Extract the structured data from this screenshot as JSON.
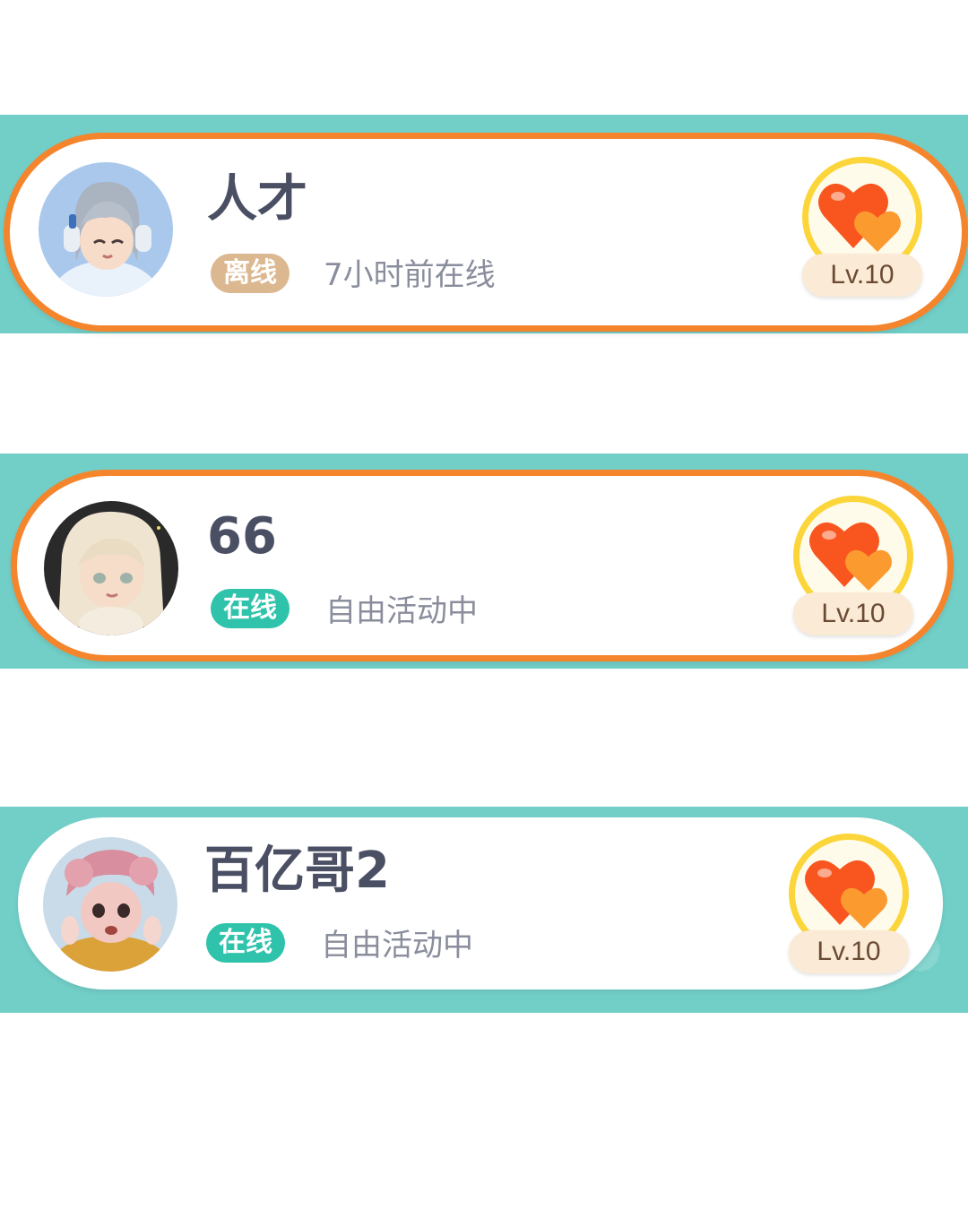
{
  "friends": [
    {
      "name": "人才",
      "status_label": "离线",
      "status_color": "#dcb891",
      "status_detail": "7小时前在线",
      "level": "Lv.10",
      "selected": true
    },
    {
      "name": "66",
      "status_label": "在线",
      "status_color": "#2fc3ab",
      "status_detail": "自由活动中",
      "level": "Lv.10",
      "selected": true
    },
    {
      "name": "百亿哥2",
      "status_label": "在线",
      "status_color": "#2fc3ab",
      "status_detail": "自由活动中",
      "level": "Lv.10",
      "selected": false
    }
  ],
  "theme": {
    "strip_color": "#72cfc8",
    "selected_border": "#f5852c",
    "heart_color": "#f86a1e",
    "ring_color": "#fbd53a"
  }
}
